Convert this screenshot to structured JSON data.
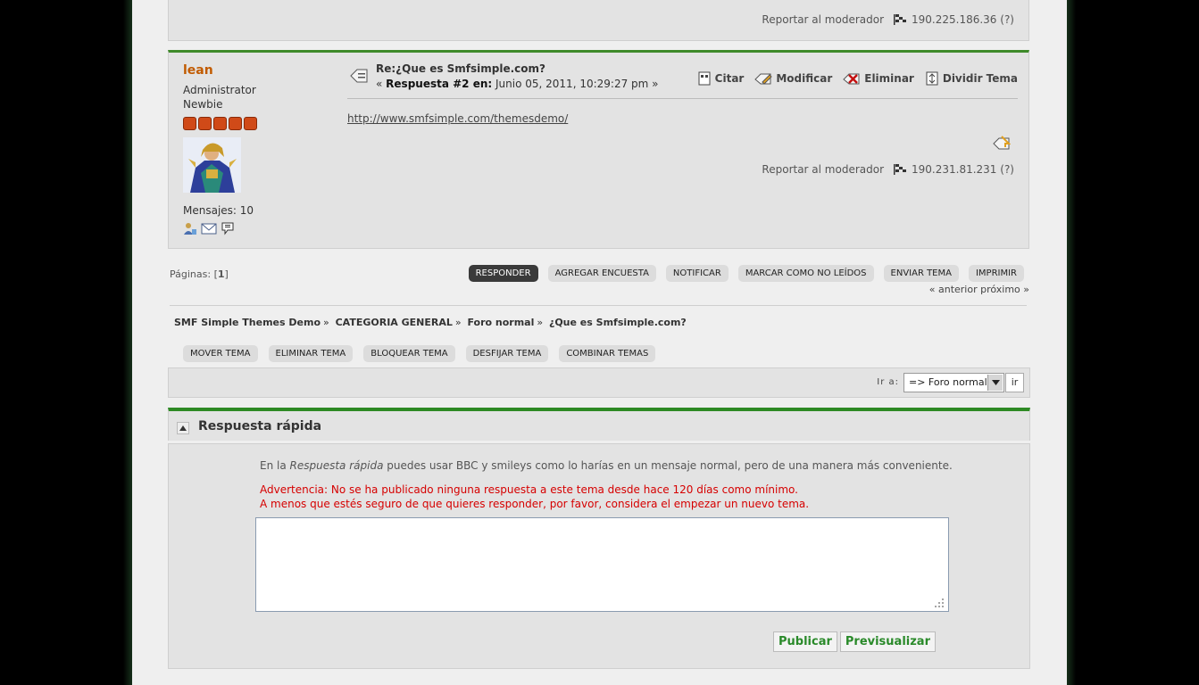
{
  "previous_post": {
    "report_link": "Reportar al moderador",
    "ip": "190.225.186.36 (?)"
  },
  "post": {
    "poster": {
      "name": "lean",
      "group": "Administrator",
      "rank": "Newbie",
      "star_count": 5,
      "posts_line": "Mensajes: 10"
    },
    "subject": "Re:¿Que es Smfsimple.com?",
    "reply_prefix": "«",
    "reply_label": "Respuesta #2 en:",
    "reply_date": "Junio 05, 2011, 10:29:27 pm »",
    "actions": {
      "quote": "Citar",
      "modify": "Modificar",
      "delete": "Eliminar",
      "split": "Dividir Tema"
    },
    "body_link": "http://www.smfsimple.com/themesdemo/",
    "report_link": "Reportar al moderador",
    "ip": "190.231.81.231 (?)"
  },
  "pagination": {
    "label": "Páginas: [",
    "current": "1",
    "close": "]",
    "prevnext": "« anterior próximo »"
  },
  "topic_buttons": {
    "reply": "RESPONDER",
    "add_poll": "AGREGAR ENCUESTA",
    "notify": "NOTIFICAR",
    "mark_unread": "MARCAR COMO NO LEÍDOS",
    "send_topic": "ENVIAR TEMA",
    "print": "IMPRIMIR"
  },
  "breadcrumb": {
    "forum": "SMF Simple Themes Demo",
    "category": "CATEGORIA GENERAL",
    "board": "Foro normal",
    "topic": "¿Que es Smfsimple.com?",
    "separator": "»"
  },
  "mod_buttons": {
    "move": "MOVER TEMA",
    "delete": "ELIMINAR TEMA",
    "lock": "BLOQUEAR TEMA",
    "unsticky": "DESFIJAR TEMA",
    "merge": "COMBINAR TEMAS"
  },
  "jump_to": {
    "label": "Ir a:",
    "selected": "=> Foro normal",
    "go": "ir"
  },
  "quick_reply": {
    "title": "Respuesta rápida",
    "intro_pre": "En la ",
    "intro_em": "Respuesta rápida",
    "intro_post": " puedes usar BBC y smileys como lo harías en un mensaje normal, pero de una manera más conveniente.",
    "warning_1": "Advertencia: No se ha publicado ninguna respuesta a este tema desde hace 120 días como mínimo.",
    "warning_2": "A menos que estés seguro de que quieres responder, por favor, considera el empezar un nuevo tema.",
    "textarea_value": "",
    "publish": "Publicar",
    "preview": "Previsualizar"
  },
  "colors": {
    "accent_green": "#2e8a24",
    "poster_name": "#c15b00",
    "warning_red": "#d60000",
    "button_green": "#2a8a2a"
  }
}
